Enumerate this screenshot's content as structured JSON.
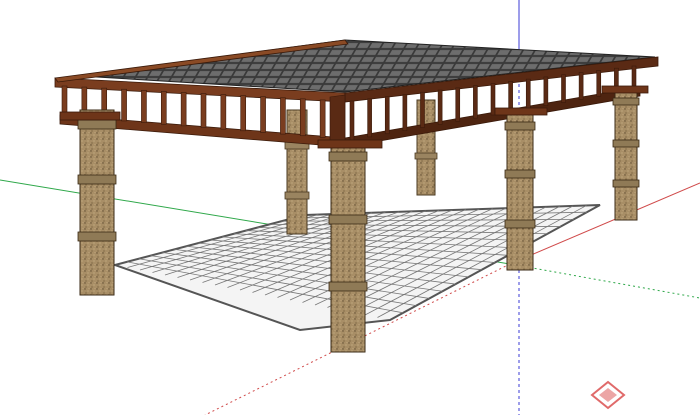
{
  "scene": {
    "subject": "pergola",
    "colors": {
      "background": "#ffffff",
      "wood_dark": "#5a2a14",
      "wood_mid": "#7a3d1f",
      "wood_light": "#9a5a33",
      "pillar_light": "#b49b72",
      "pillar_dark": "#8a7352",
      "pillar_speck": "#5e4a30",
      "grid_roof": "#222222",
      "grid_shadow": "#666666",
      "axis_red": "#d04a4a",
      "axis_green": "#2fa84a",
      "axis_blue": "#3b3bd6",
      "watermark": "#e06a6a"
    }
  },
  "watermark": {
    "icon": "diamond-logo-icon"
  }
}
